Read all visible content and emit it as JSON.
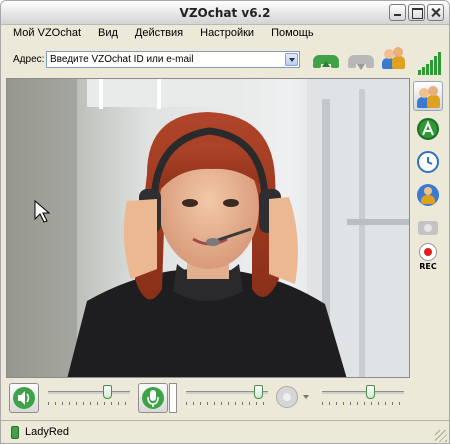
{
  "window": {
    "title": "VZOchat v6.2"
  },
  "menu": {
    "items": [
      {
        "label": "Мой VZOchat"
      },
      {
        "label": "Вид"
      },
      {
        "label": "Действия"
      },
      {
        "label": "Настройки"
      },
      {
        "label": "Помощь"
      }
    ]
  },
  "address": {
    "label": "Адрес:",
    "placeholder": "Введите VZOchat ID или e-mail"
  },
  "toolbar": {
    "call_icon": "call-answer-icon",
    "hangup_icon": "call-hangup-icon",
    "contacts_icon": "contacts-icon",
    "signal_icon": "signal-strength-icon"
  },
  "sidebar": {
    "items": [
      {
        "name": "contacts-icon",
        "color": "#e0a020"
      },
      {
        "name": "chat-icon",
        "color": "#2e9a36"
      },
      {
        "name": "history-clock-icon",
        "color": "#2f6fc0"
      },
      {
        "name": "user-info-icon",
        "color": "#e0a020"
      },
      {
        "name": "snapshot-camera-icon",
        "color": "#b0b0b0"
      },
      {
        "name": "record-icon",
        "color": "#e02020",
        "label": "REC"
      }
    ]
  },
  "controls": {
    "speaker_volume": 0.75,
    "mic_volume": 0.93,
    "camera_level": 0.6
  },
  "status": {
    "username": "LadyRed"
  },
  "colors": {
    "accent_green": "#3fa247",
    "record_red": "#e02020"
  }
}
